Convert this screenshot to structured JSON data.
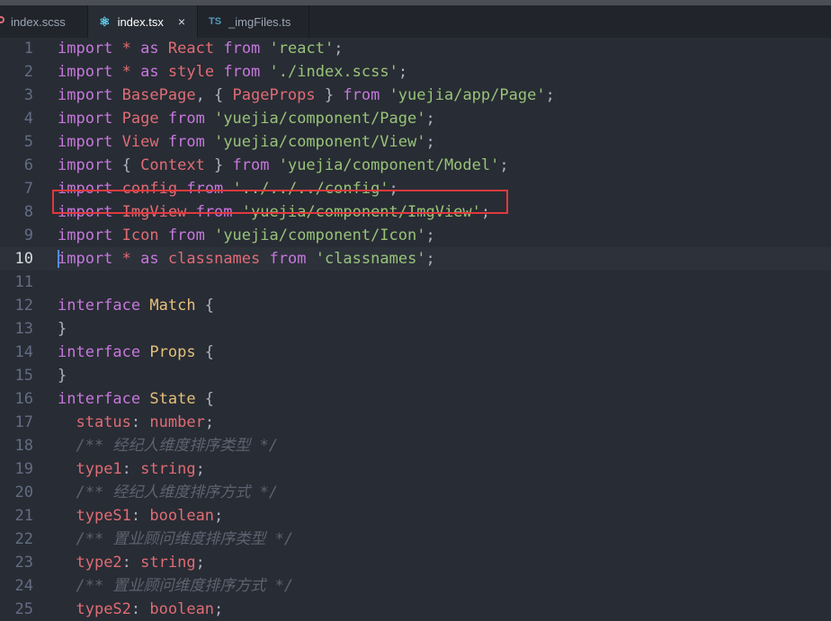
{
  "tabs": [
    {
      "label": "index.scss",
      "icon": "",
      "modified": true,
      "active": false
    },
    {
      "label": "index.tsx",
      "icon": "⚛",
      "active": true,
      "close": "×"
    },
    {
      "label": "_imgFiles.ts",
      "icon": "TS",
      "active": false
    }
  ],
  "colors": {
    "keyword": "#c678dd",
    "identifier": "#e06c75",
    "string": "#98c379",
    "type": "#e5c07b",
    "comment": "#5c6370",
    "highlight_box": "#e0393e"
  },
  "current_line": 10,
  "highlighted_line": 9,
  "lines": [
    {
      "n": "1",
      "tokens": [
        [
          "kw",
          "import"
        ],
        [
          "pl",
          " "
        ],
        [
          "id",
          "*"
        ],
        [
          "pl",
          " "
        ],
        [
          "kw",
          "as"
        ],
        [
          "pl",
          " "
        ],
        [
          "id",
          "React"
        ],
        [
          "pl",
          " "
        ],
        [
          "kw",
          "from"
        ],
        [
          "pl",
          " "
        ],
        [
          "str",
          "'react'"
        ],
        [
          "pl",
          ";"
        ]
      ]
    },
    {
      "n": "2",
      "tokens": [
        [
          "kw",
          "import"
        ],
        [
          "pl",
          " "
        ],
        [
          "id",
          "*"
        ],
        [
          "pl",
          " "
        ],
        [
          "kw",
          "as"
        ],
        [
          "pl",
          " "
        ],
        [
          "id",
          "style"
        ],
        [
          "pl",
          " "
        ],
        [
          "kw",
          "from"
        ],
        [
          "pl",
          " "
        ],
        [
          "str",
          "'./index.scss'"
        ],
        [
          "pl",
          ";"
        ]
      ]
    },
    {
      "n": "3",
      "tokens": [
        [
          "kw",
          "import"
        ],
        [
          "pl",
          " "
        ],
        [
          "id",
          "BasePage"
        ],
        [
          "pl",
          ", { "
        ],
        [
          "id",
          "PageProps"
        ],
        [
          "pl",
          " } "
        ],
        [
          "kw",
          "from"
        ],
        [
          "pl",
          " "
        ],
        [
          "str",
          "'yuejia/app/Page'"
        ],
        [
          "pl",
          ";"
        ]
      ]
    },
    {
      "n": "4",
      "tokens": [
        [
          "kw",
          "import"
        ],
        [
          "pl",
          " "
        ],
        [
          "id",
          "Page"
        ],
        [
          "pl",
          " "
        ],
        [
          "kw",
          "from"
        ],
        [
          "pl",
          " "
        ],
        [
          "str",
          "'yuejia/component/Page'"
        ],
        [
          "pl",
          ";"
        ]
      ]
    },
    {
      "n": "5",
      "tokens": [
        [
          "kw",
          "import"
        ],
        [
          "pl",
          " "
        ],
        [
          "id",
          "View"
        ],
        [
          "pl",
          " "
        ],
        [
          "kw",
          "from"
        ],
        [
          "pl",
          " "
        ],
        [
          "str",
          "'yuejia/component/View'"
        ],
        [
          "pl",
          ";"
        ]
      ]
    },
    {
      "n": "6",
      "tokens": [
        [
          "kw",
          "import"
        ],
        [
          "pl",
          " { "
        ],
        [
          "id",
          "Context"
        ],
        [
          "pl",
          " } "
        ],
        [
          "kw",
          "from"
        ],
        [
          "pl",
          " "
        ],
        [
          "str",
          "'yuejia/component/Model'"
        ],
        [
          "pl",
          ";"
        ]
      ]
    },
    {
      "n": "7",
      "tokens": [
        [
          "kw",
          "import"
        ],
        [
          "pl",
          " "
        ],
        [
          "id",
          "config"
        ],
        [
          "pl",
          " "
        ],
        [
          "kw",
          "from"
        ],
        [
          "pl",
          " "
        ],
        [
          "str",
          "'../../../config'"
        ],
        [
          "pl",
          ";"
        ]
      ]
    },
    {
      "n": "8",
      "tokens": [
        [
          "kw",
          "import"
        ],
        [
          "pl",
          " "
        ],
        [
          "id",
          "ImgView"
        ],
        [
          "pl",
          " "
        ],
        [
          "kw",
          "from"
        ],
        [
          "pl",
          " "
        ],
        [
          "str",
          "'yuejia/component/ImgView'"
        ],
        [
          "pl",
          ";"
        ]
      ]
    },
    {
      "n": "9",
      "tokens": [
        [
          "kw",
          "import"
        ],
        [
          "pl",
          " "
        ],
        [
          "id",
          "Icon"
        ],
        [
          "pl",
          " "
        ],
        [
          "kw",
          "from"
        ],
        [
          "pl",
          " "
        ],
        [
          "str",
          "'yuejia/component/Icon'"
        ],
        [
          "pl",
          ";"
        ]
      ]
    },
    {
      "n": "10",
      "tokens": [
        [
          "kw",
          "import"
        ],
        [
          "pl",
          " "
        ],
        [
          "id",
          "*"
        ],
        [
          "pl",
          " "
        ],
        [
          "kw",
          "as"
        ],
        [
          "pl",
          " "
        ],
        [
          "id",
          "classnames"
        ],
        [
          "pl",
          " "
        ],
        [
          "kw",
          "from"
        ],
        [
          "pl",
          " "
        ],
        [
          "str",
          "'classnames'"
        ],
        [
          "pl",
          ";"
        ]
      ]
    },
    {
      "n": "11",
      "tokens": []
    },
    {
      "n": "12",
      "tokens": [
        [
          "kw",
          "interface"
        ],
        [
          "pl",
          " "
        ],
        [
          "ty",
          "Match"
        ],
        [
          "pl",
          " {"
        ]
      ]
    },
    {
      "n": "13",
      "tokens": [
        [
          "pl",
          "}"
        ]
      ]
    },
    {
      "n": "14",
      "tokens": [
        [
          "kw",
          "interface"
        ],
        [
          "pl",
          " "
        ],
        [
          "ty",
          "Props"
        ],
        [
          "pl",
          " {"
        ]
      ]
    },
    {
      "n": "15",
      "tokens": [
        [
          "pl",
          "}"
        ]
      ]
    },
    {
      "n": "16",
      "tokens": [
        [
          "kw",
          "interface"
        ],
        [
          "pl",
          " "
        ],
        [
          "ty",
          "State"
        ],
        [
          "pl",
          " {"
        ]
      ]
    },
    {
      "n": "17",
      "tokens": [
        [
          "pl",
          "  "
        ],
        [
          "id",
          "status"
        ],
        [
          "pl",
          ": "
        ],
        [
          "id",
          "number"
        ],
        [
          "pl",
          ";"
        ]
      ]
    },
    {
      "n": "18",
      "tokens": [
        [
          "pl",
          "  "
        ],
        [
          "cm",
          "/** 经纪人维度排序类型 */"
        ]
      ]
    },
    {
      "n": "19",
      "tokens": [
        [
          "pl",
          "  "
        ],
        [
          "id",
          "type1"
        ],
        [
          "pl",
          ": "
        ],
        [
          "id",
          "string"
        ],
        [
          "pl",
          ";"
        ]
      ]
    },
    {
      "n": "20",
      "tokens": [
        [
          "pl",
          "  "
        ],
        [
          "cm",
          "/** 经纪人维度排序方式 */"
        ]
      ]
    },
    {
      "n": "21",
      "tokens": [
        [
          "pl",
          "  "
        ],
        [
          "id",
          "typeS1"
        ],
        [
          "pl",
          ": "
        ],
        [
          "id",
          "boolean"
        ],
        [
          "pl",
          ";"
        ]
      ]
    },
    {
      "n": "22",
      "tokens": [
        [
          "pl",
          "  "
        ],
        [
          "cm",
          "/** 置业顾问维度排序类型 */"
        ]
      ]
    },
    {
      "n": "23",
      "tokens": [
        [
          "pl",
          "  "
        ],
        [
          "id",
          "type2"
        ],
        [
          "pl",
          ": "
        ],
        [
          "id",
          "string"
        ],
        [
          "pl",
          ";"
        ]
      ]
    },
    {
      "n": "24",
      "tokens": [
        [
          "pl",
          "  "
        ],
        [
          "cm",
          "/** 置业顾问维度排序方式 */"
        ]
      ]
    },
    {
      "n": "25",
      "tokens": [
        [
          "pl",
          "  "
        ],
        [
          "id",
          "typeS2"
        ],
        [
          "pl",
          ": "
        ],
        [
          "id",
          "boolean"
        ],
        [
          "pl",
          ";"
        ]
      ]
    }
  ]
}
